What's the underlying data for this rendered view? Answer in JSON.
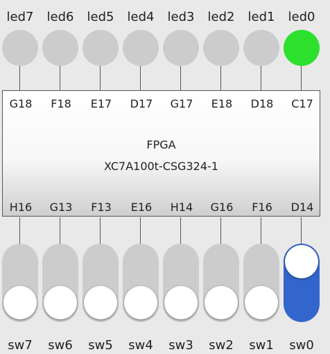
{
  "leds": [
    {
      "label": "led7",
      "on": false
    },
    {
      "label": "led6",
      "on": false
    },
    {
      "label": "led5",
      "on": false
    },
    {
      "label": "led4",
      "on": false
    },
    {
      "label": "led3",
      "on": false
    },
    {
      "label": "led2",
      "on": false
    },
    {
      "label": "led1",
      "on": false
    },
    {
      "label": "led0",
      "on": true
    }
  ],
  "fpga": {
    "title": "FPGA",
    "part": "XC7A100t-CSG324-1",
    "top_pins": [
      "G18",
      "F18",
      "E17",
      "D17",
      "G17",
      "E18",
      "D18",
      "C17"
    ],
    "bottom_pins": [
      "H16",
      "G13",
      "F13",
      "E16",
      "H14",
      "G16",
      "F16",
      "D14"
    ]
  },
  "switches": [
    {
      "label": "sw7",
      "on": false
    },
    {
      "label": "sw6",
      "on": false
    },
    {
      "label": "sw5",
      "on": false
    },
    {
      "label": "sw4",
      "on": false
    },
    {
      "label": "sw3",
      "on": false
    },
    {
      "label": "sw2",
      "on": false
    },
    {
      "label": "sw1",
      "on": false
    },
    {
      "label": "sw0",
      "on": true
    }
  ],
  "colors": {
    "led_on": "#2ee02e",
    "led_off": "#cccccc",
    "switch_on": "#3366cc",
    "switch_off": "#cccccc"
  }
}
